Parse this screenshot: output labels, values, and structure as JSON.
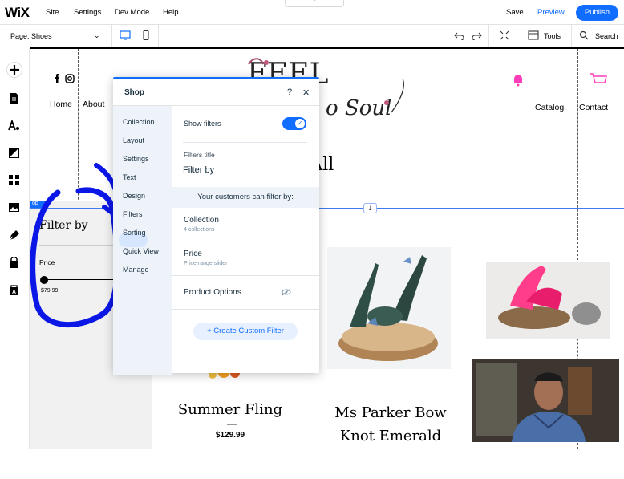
{
  "topbar": {
    "logo": "WiX",
    "menu": [
      "Site",
      "Settings",
      "Dev Mode",
      "Help"
    ],
    "save": "Save",
    "preview": "Preview",
    "publish": "Publish"
  },
  "secbar": {
    "page_label": "Page:",
    "page_value": "Shoes",
    "tools": "Tools",
    "search": "Search"
  },
  "site": {
    "nav_left": [
      "Home",
      "About"
    ],
    "nav_right": [
      "Catalog",
      "Contact"
    ],
    "shop_heading": "op All",
    "shop_tag": "op",
    "filter_title": "Filter by",
    "price_label": "Price",
    "price_min": "$79.99",
    "products": [
      {
        "name": "Summer Fling",
        "price": "$129.99"
      },
      {
        "name": "Ms Parker Bow Knot Emerald",
        "price": ""
      }
    ]
  },
  "panel": {
    "title": "Shop",
    "help": "?",
    "close": "✕",
    "nav": [
      "Collection",
      "Layout",
      "Settings",
      "Text",
      "Design",
      "Filters",
      "Sorting",
      "Quick View",
      "Manage"
    ],
    "active_nav": "Filters",
    "show_filters_label": "Show filters",
    "show_filters_on": true,
    "filters_title_label": "Filters title",
    "filters_title_value": "Filter by",
    "customers_label": "Your customers can filter by:",
    "filters": [
      {
        "title": "Collection",
        "sub": "4 collections"
      },
      {
        "title": "Price",
        "sub": "Price range slider"
      },
      {
        "title": "Product Options",
        "sub": ""
      }
    ],
    "cta": "+ Create Custom Filter"
  },
  "colors": {
    "accent": "#116dff",
    "annotation": "#0b17e6",
    "pink": "#ff3dbb"
  }
}
